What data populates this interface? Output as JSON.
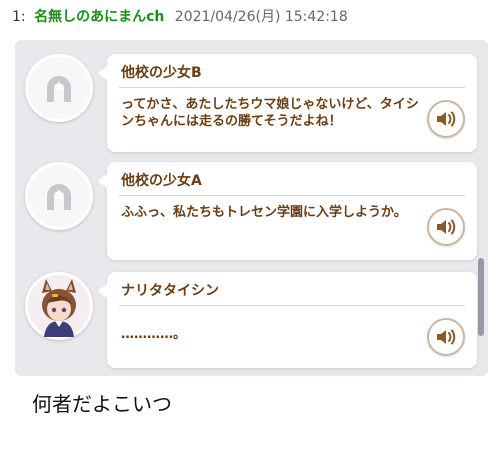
{
  "post": {
    "number": "1:",
    "name": "名無しのあにまんch",
    "datetime": "2021/04/26(月) 15:42:18"
  },
  "dialogue": [
    {
      "speaker": "他校の少女B",
      "message": "ってかさ、あたしたちウマ娘じゃないけど、タイシンちゃんには走るの勝てそうだよね！",
      "avatar": "horseshoe-placeholder-icon"
    },
    {
      "speaker": "他校の少女A",
      "message": "ふふっ、私たちもトレセン学園に入学しようか。",
      "avatar": "horseshoe-placeholder-icon"
    },
    {
      "speaker": "ナリタタイシン",
      "message": "…………。",
      "avatar": "horse-girl-portrait"
    }
  ],
  "comment": "何者だよこいつ",
  "colors": {
    "name_green": "#1a8f1a",
    "dialogue_brown": "#6a3d12",
    "panel_bg": "#e9e8ec",
    "voice_icon": "#8a5a2b"
  }
}
